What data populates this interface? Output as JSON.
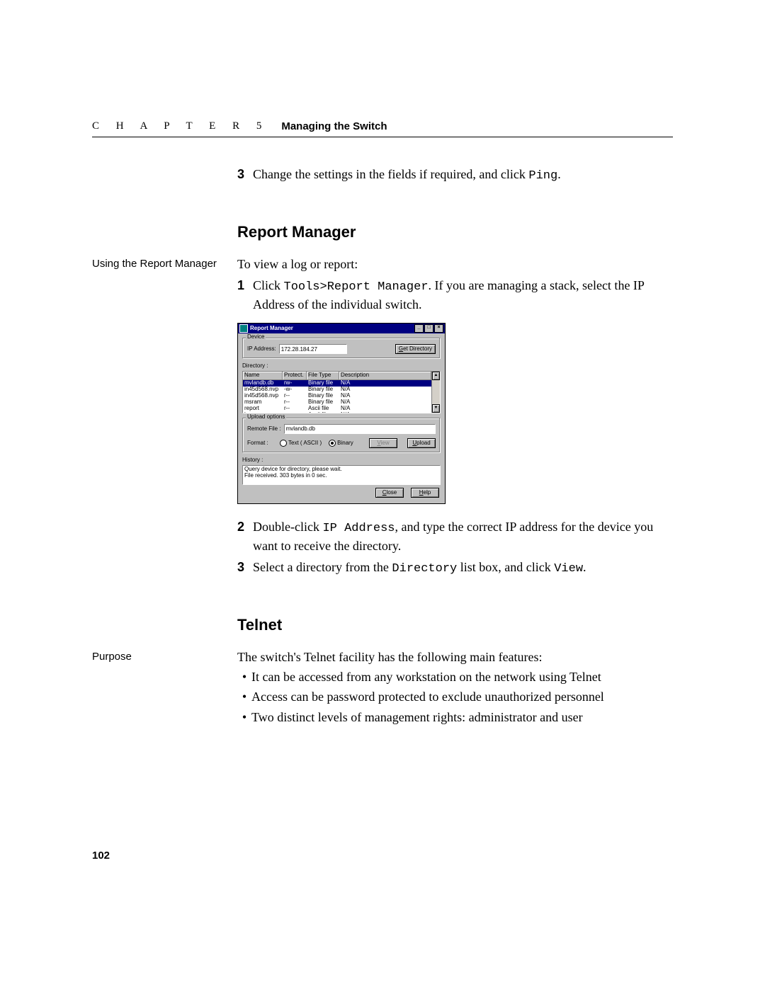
{
  "header": {
    "chapter_spaced": "C H A P T E R 5",
    "chapter_title": "Managing the Switch"
  },
  "step3_top": {
    "num": "3",
    "before": "Change the settings in the fields if required, and click ",
    "code": "Ping",
    "after": "."
  },
  "report_manager": {
    "heading": "Report Manager",
    "margin_label": "Using the Report Manager",
    "intro": "To view a log or report:",
    "step1": {
      "num": "1",
      "before": "Click ",
      "code": "Tools>Report Manager",
      "after": ". If you are managing a stack, select the IP Address of the individual switch."
    },
    "step2": {
      "num": "2",
      "before": "Double-click ",
      "code": "IP Address",
      "after": ", and type the correct IP address for the device you want to receive the directory."
    },
    "step3": {
      "num": "3",
      "before1": "Select a directory from the ",
      "code1": "Directory",
      "mid": " list box, and click ",
      "code2": "View",
      "after": "."
    }
  },
  "dialog": {
    "title": "Report Manager",
    "device_legend": "Device",
    "ip_label": "IP Address:",
    "ip_value": "172.28.184.27",
    "get_dir_btn": "Get Directory",
    "directory_label": "Directory :",
    "cols": {
      "name": "Name",
      "protect": "Protect.",
      "filetype": "File Type",
      "desc": "Description"
    },
    "rows": [
      {
        "name": "mvlandb.db",
        "protect": "rw-",
        "type": "Binary file",
        "desc": "N/A",
        "selected": true
      },
      {
        "name": "in45d568.nvp",
        "protect": "-w-",
        "type": "Binary file",
        "desc": "N/A"
      },
      {
        "name": "in45d568.nvp",
        "protect": "r--",
        "type": "Binary file",
        "desc": "N/A"
      },
      {
        "name": "msram",
        "protect": "r--",
        "type": "Binary file",
        "desc": "N/A"
      },
      {
        "name": "report",
        "protect": "r--",
        "type": "Ascii file",
        "desc": "N/A"
      },
      {
        "name": "log",
        "protect": "r--",
        "type": "Ascii file",
        "desc": "N/A"
      }
    ],
    "upload_legend": "Upload options",
    "remote_file_label": "Remote File :",
    "remote_file_value": "mvlandb.db",
    "format_label": "Format :",
    "radio_text": "Text ( ASCII )",
    "radio_binary": "Binary",
    "view_btn": "View",
    "upload_btn": "Upload",
    "history_label": "History :",
    "history_line1": "Query device for directory, please wait.",
    "history_line2": "File received. 303 bytes in 0 sec.",
    "close_btn": "Close",
    "help_btn": "Help"
  },
  "telnet": {
    "heading": "Telnet",
    "margin_label": "Purpose",
    "intro": "The switch's Telnet facility has the following main features:",
    "bullets": [
      "It can be accessed from any workstation on the network using Telnet",
      "Access can be password protected to exclude unauthorized personnel",
      "Two distinct levels of management rights: administrator and user"
    ]
  },
  "page_number": "102"
}
